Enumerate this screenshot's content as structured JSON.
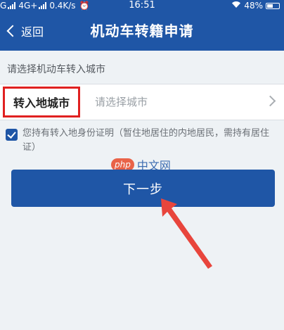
{
  "status_bar": {
    "carrier": "G",
    "network": "4G+",
    "speed": "0.4K/s",
    "time": "16:51",
    "battery_percent": "48%",
    "battery_level": 0.48
  },
  "navbar": {
    "back_label": "返回",
    "title": "机动车转籍申请"
  },
  "form": {
    "section_label": "请选择机动车转入城市",
    "city_label": "转入地城市",
    "city_placeholder": "请选择城市",
    "confirm_checked": true,
    "confirm_text": "您持有转入地身份证明（暂住地居住的内地居民，需持有居住证）"
  },
  "watermark": {
    "logo": "php",
    "text": "中文网"
  },
  "actions": {
    "next_label": "下一步"
  },
  "colors": {
    "primary": "#1f56a6",
    "highlight_border": "#e02020",
    "arrow": "#e8453c"
  }
}
